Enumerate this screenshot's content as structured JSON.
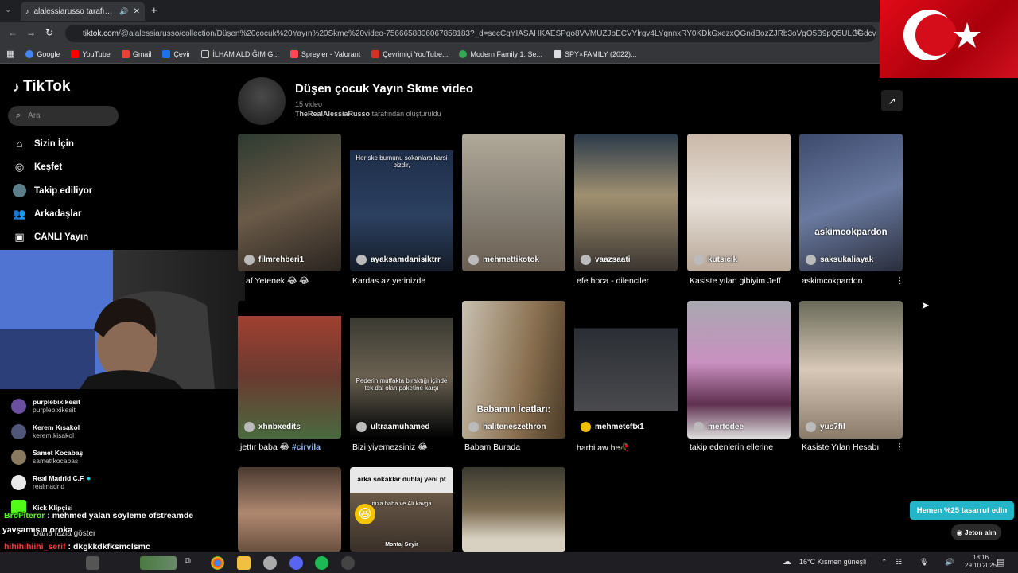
{
  "browser": {
    "tab_title": "alalessiarusso tarafından olu",
    "url_host": "tiktok.com",
    "url_path": "/@alalessiarusso/collection/Düşen%20çocuk%20Yayın%20Skme%20video-7566658806067858183?_d=secCgYIASAHKAESPgo8VVMUZJbECVYlrgv4LYgnnxRY0KDkGxezxQGndBozZJRb3oVgO5B9pQ5ULCGdcvMWzJeEkasHJeh...",
    "bookmarks": [
      "Google",
      "YouTube",
      "Gmail",
      "Çevir",
      "İLHAM ALDIĞIM G...",
      "Spreyler - Valorant",
      "Çevrimiçi YouTube...",
      "Modern Family 1. Se...",
      "SPY×FAMILY (2022)..."
    ]
  },
  "sidebar": {
    "brand": "TikTok",
    "search_placeholder": "Ara",
    "nav": [
      "Sizin İçin",
      "Keşfet",
      "Takip ediliyor",
      "Arkadaşlar",
      "CANLI Yayın"
    ],
    "following": [
      {
        "name": "purplebixikesit",
        "handle": "purplebixikesit"
      },
      {
        "name": "Kerem Kısakol",
        "handle": "kerem.kisakol"
      },
      {
        "name": "Samet Kocabaş",
        "handle": "samettkocabas"
      },
      {
        "name": "Real Madrid C.F.",
        "handle": "realmadrid"
      },
      {
        "name": "Kick Klipçisi",
        "handle": ""
      }
    ],
    "more_label": "Daha fazla göster"
  },
  "chat": [
    {
      "user": "BroFiteror",
      "msg": "mehmed yalan söyleme ofstreamde"
    },
    {
      "user": "",
      "msg": "yavşamışın oroka"
    },
    {
      "user": "hihihihiihi_serif",
      "msg": "dkgkkdkfksmclsmc"
    },
    {
      "user": "hihihihiihi_serif",
      "msg": ""
    }
  ],
  "collection": {
    "title": "Düşen çocuk Yayın Skme video",
    "count": "15 video",
    "creator": "TheRealAlessiaRusso",
    "creator_suffix": "tarafından oluşturuldu"
  },
  "videos": [
    {
      "user": "filmrehberi1",
      "caption": "af Yetenek 😂 😂"
    },
    {
      "user": "ayaksamdanisiktrr",
      "caption": "Kardas az yerinizde",
      "overlay": "Her ske burnunu sokanlara karsi bizdir,"
    },
    {
      "user": "mehmettikotok",
      "caption": ""
    },
    {
      "user": "vaazsaati",
      "caption": "efe hoca - dilenciler"
    },
    {
      "user": "kutsicik",
      "caption": "Kasiste yılan gibiyim Jeff"
    },
    {
      "user": "saksukaliayak_",
      "caption": "askimcokpardon",
      "overlay": "askimcokpardon"
    },
    {
      "user": "xhnbxedits",
      "caption": "jettır baba 😂",
      "tag": "#cirvila"
    },
    {
      "user": "ultraamuhamed",
      "caption": "Bizi yiyemezsiniz 😂",
      "overlay": "Pederin mutfakta bıraktığı içinde tek dal olan paketine karşı"
    },
    {
      "user": "haliteneszethron",
      "caption": "Babam Burada",
      "overlay": "Babamın İcatları:"
    },
    {
      "user": "mehmetcftx1",
      "caption": "harbi aw he🥀"
    },
    {
      "user": "mertodee",
      "caption": "takip edenlerin ellerine"
    },
    {
      "user": "yus7fil",
      "caption": "Kasiste Yılan Hesabı"
    },
    {
      "user": "",
      "caption": ""
    },
    {
      "user": "",
      "caption": "",
      "overlay": "arka sokaklar dublaj yeni pt",
      "overlay2": "nıza baba ve Ali kavga",
      "overlay3": "Montaj Seyir"
    },
    {
      "user": "",
      "caption": ""
    }
  ],
  "buttons": {
    "promo": "Hemen %25 tasarruf edin",
    "coins": "Jeton alın"
  },
  "taskbar": {
    "weather": "16°C  Kısmen güneşli",
    "time": "18:16",
    "date": "29.10.2025"
  },
  "colors": {
    "accent_promo": "#25b5c8",
    "flag_red": "#e30a17"
  }
}
